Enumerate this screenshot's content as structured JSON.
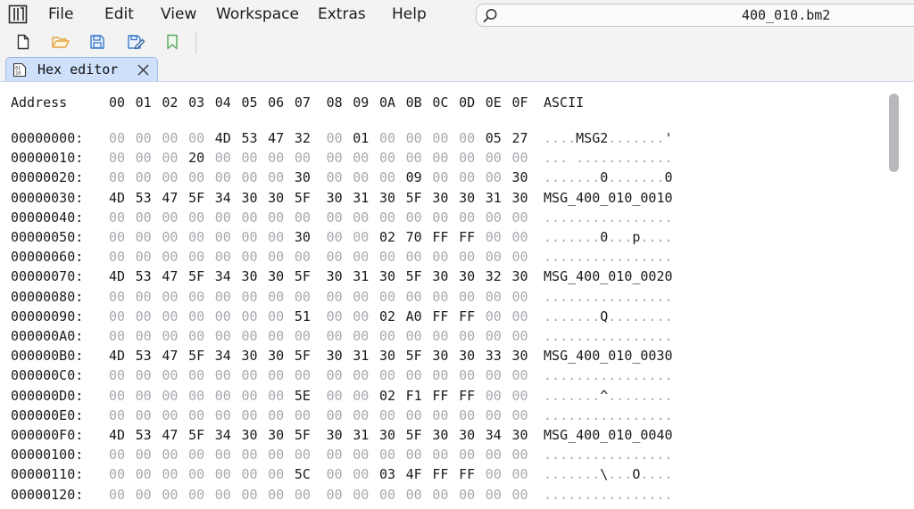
{
  "menu": {
    "items": [
      {
        "label": "File"
      },
      {
        "label": "Edit"
      },
      {
        "label": "View"
      },
      {
        "label": "Workspace"
      },
      {
        "label": "Extras"
      },
      {
        "label": "Help"
      }
    ]
  },
  "search": {
    "icon": "search-icon",
    "filename": "400_010.bm2"
  },
  "toolbar": {
    "buttons": [
      {
        "icon": "new-file-icon"
      },
      {
        "icon": "open-folder-icon"
      },
      {
        "icon": "save-icon"
      },
      {
        "icon": "save-as-icon"
      },
      {
        "icon": "bookmark-icon"
      }
    ]
  },
  "tabs": [
    {
      "label": "Hex editor",
      "icon": "hex-file-icon",
      "close_icon": "close-icon"
    }
  ],
  "hex": {
    "header": {
      "address_label": "Address",
      "columns": [
        "00",
        "01",
        "02",
        "03",
        "04",
        "05",
        "06",
        "07",
        "08",
        "09",
        "0A",
        "0B",
        "0C",
        "0D",
        "0E",
        "0F"
      ],
      "ascii_label": "ASCII"
    },
    "rows": [
      {
        "address": "00000000:",
        "bytes": [
          "00",
          "00",
          "00",
          "00",
          "4D",
          "53",
          "47",
          "32",
          "00",
          "01",
          "00",
          "00",
          "00",
          "00",
          "05",
          "27"
        ],
        "ascii": "....MSG2.......'"
      },
      {
        "address": "00000010:",
        "bytes": [
          "00",
          "00",
          "00",
          "20",
          "00",
          "00",
          "00",
          "00",
          "00",
          "00",
          "00",
          "00",
          "00",
          "00",
          "00",
          "00"
        ],
        "ascii": "... ............"
      },
      {
        "address": "00000020:",
        "bytes": [
          "00",
          "00",
          "00",
          "00",
          "00",
          "00",
          "00",
          "30",
          "00",
          "00",
          "00",
          "09",
          "00",
          "00",
          "00",
          "30"
        ],
        "ascii": ".......0.......0"
      },
      {
        "address": "00000030:",
        "bytes": [
          "4D",
          "53",
          "47",
          "5F",
          "34",
          "30",
          "30",
          "5F",
          "30",
          "31",
          "30",
          "5F",
          "30",
          "30",
          "31",
          "30"
        ],
        "ascii": "MSG_400_010_0010"
      },
      {
        "address": "00000040:",
        "bytes": [
          "00",
          "00",
          "00",
          "00",
          "00",
          "00",
          "00",
          "00",
          "00",
          "00",
          "00",
          "00",
          "00",
          "00",
          "00",
          "00"
        ],
        "ascii": "................"
      },
      {
        "address": "00000050:",
        "bytes": [
          "00",
          "00",
          "00",
          "00",
          "00",
          "00",
          "00",
          "30",
          "00",
          "00",
          "02",
          "70",
          "FF",
          "FF",
          "00",
          "00"
        ],
        "ascii": ".......0...p...."
      },
      {
        "address": "00000060:",
        "bytes": [
          "00",
          "00",
          "00",
          "00",
          "00",
          "00",
          "00",
          "00",
          "00",
          "00",
          "00",
          "00",
          "00",
          "00",
          "00",
          "00"
        ],
        "ascii": "................"
      },
      {
        "address": "00000070:",
        "bytes": [
          "4D",
          "53",
          "47",
          "5F",
          "34",
          "30",
          "30",
          "5F",
          "30",
          "31",
          "30",
          "5F",
          "30",
          "30",
          "32",
          "30"
        ],
        "ascii": "MSG_400_010_0020"
      },
      {
        "address": "00000080:",
        "bytes": [
          "00",
          "00",
          "00",
          "00",
          "00",
          "00",
          "00",
          "00",
          "00",
          "00",
          "00",
          "00",
          "00",
          "00",
          "00",
          "00"
        ],
        "ascii": "................"
      },
      {
        "address": "00000090:",
        "bytes": [
          "00",
          "00",
          "00",
          "00",
          "00",
          "00",
          "00",
          "51",
          "00",
          "00",
          "02",
          "A0",
          "FF",
          "FF",
          "00",
          "00"
        ],
        "ascii": ".......Q........"
      },
      {
        "address": "000000A0:",
        "bytes": [
          "00",
          "00",
          "00",
          "00",
          "00",
          "00",
          "00",
          "00",
          "00",
          "00",
          "00",
          "00",
          "00",
          "00",
          "00",
          "00"
        ],
        "ascii": "................"
      },
      {
        "address": "000000B0:",
        "bytes": [
          "4D",
          "53",
          "47",
          "5F",
          "34",
          "30",
          "30",
          "5F",
          "30",
          "31",
          "30",
          "5F",
          "30",
          "30",
          "33",
          "30"
        ],
        "ascii": "MSG_400_010_0030"
      },
      {
        "address": "000000C0:",
        "bytes": [
          "00",
          "00",
          "00",
          "00",
          "00",
          "00",
          "00",
          "00",
          "00",
          "00",
          "00",
          "00",
          "00",
          "00",
          "00",
          "00"
        ],
        "ascii": "................"
      },
      {
        "address": "000000D0:",
        "bytes": [
          "00",
          "00",
          "00",
          "00",
          "00",
          "00",
          "00",
          "5E",
          "00",
          "00",
          "02",
          "F1",
          "FF",
          "FF",
          "00",
          "00"
        ],
        "ascii": ".......^........"
      },
      {
        "address": "000000E0:",
        "bytes": [
          "00",
          "00",
          "00",
          "00",
          "00",
          "00",
          "00",
          "00",
          "00",
          "00",
          "00",
          "00",
          "00",
          "00",
          "00",
          "00"
        ],
        "ascii": "................"
      },
      {
        "address": "000000F0:",
        "bytes": [
          "4D",
          "53",
          "47",
          "5F",
          "34",
          "30",
          "30",
          "5F",
          "30",
          "31",
          "30",
          "5F",
          "30",
          "30",
          "34",
          "30"
        ],
        "ascii": "MSG_400_010_0040"
      },
      {
        "address": "00000100:",
        "bytes": [
          "00",
          "00",
          "00",
          "00",
          "00",
          "00",
          "00",
          "00",
          "00",
          "00",
          "00",
          "00",
          "00",
          "00",
          "00",
          "00"
        ],
        "ascii": "................"
      },
      {
        "address": "00000110:",
        "bytes": [
          "00",
          "00",
          "00",
          "00",
          "00",
          "00",
          "00",
          "5C",
          "00",
          "00",
          "03",
          "4F",
          "FF",
          "FF",
          "00",
          "00"
        ],
        "ascii": ".......\\...O...."
      },
      {
        "address": "00000120:",
        "bytes": [
          "00",
          "00",
          "00",
          "00",
          "00",
          "00",
          "00",
          "00",
          "00",
          "00",
          "00",
          "00",
          "00",
          "00",
          "00",
          "00"
        ],
        "ascii": "................"
      }
    ]
  },
  "colors": {
    "zero_byte": "#a6a9ae",
    "nonzero_byte": "#1a1a1a",
    "active_tab": "#cfe0fb",
    "chrome_background": "#f3f3f4"
  }
}
